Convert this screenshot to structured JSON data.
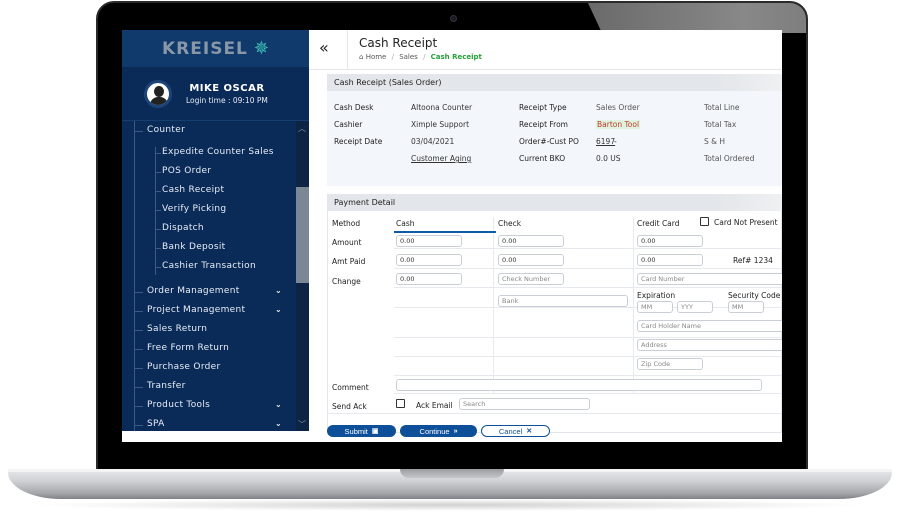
{
  "brand": {
    "name": "KREISEL",
    "logo_icon": "star-burst-icon",
    "logo_color": "#3fc0b6"
  },
  "user": {
    "name": "MIKE OSCAR",
    "login_time": "Login time : 09:10 PM"
  },
  "sidebar": {
    "groups": [
      {
        "label": "Counter",
        "expanded": true,
        "children": [
          {
            "label": "Expedite Counter Sales"
          },
          {
            "label": "POS Order"
          },
          {
            "label": "Cash Receipt"
          },
          {
            "label": "Verify Picking"
          },
          {
            "label": "Dispatch"
          },
          {
            "label": "Bank Deposit"
          },
          {
            "label": "Cashier Transaction"
          }
        ]
      },
      {
        "label": "Order Management",
        "has_children": true
      },
      {
        "label": "Project Management",
        "has_children": true
      },
      {
        "label": "Sales Return"
      },
      {
        "label": "Free Form Return"
      },
      {
        "label": "Purchase Order"
      },
      {
        "label": "Transfer"
      },
      {
        "label": "Product Tools",
        "has_children": true
      },
      {
        "label": "SPA",
        "has_children": true
      }
    ]
  },
  "header": {
    "collapse_icon": "double-chevron-left-icon",
    "title": "Cash Receipt",
    "breadcrumb": [
      {
        "label": "Home",
        "icon": "home-icon"
      },
      {
        "label": "Sales"
      },
      {
        "label": "Cash Receipt",
        "active": true
      }
    ]
  },
  "receipt_section": {
    "title": "Cash Receipt (Sales Order)",
    "fields": {
      "cash_desk_label": "Cash Desk",
      "cash_desk": "Altoona Counter",
      "cashier_label": "Cashier",
      "cashier": "Ximple Support",
      "receipt_date_label": "Receipt Date",
      "receipt_date": "03/04/2021",
      "customer_aging_link": "Customer Aging",
      "receipt_type_label": "Receipt Type",
      "receipt_type": "Sales Order",
      "receipt_from_label": "Receipt From",
      "receipt_from": "Barton Tool",
      "order_cust_po_label": "Order#-Cust PO",
      "order_number": "6197",
      "cust_po": "-",
      "current_bko_label": "Current BKO",
      "current_bko": "0.0 US",
      "total_line_label": "Total Line",
      "total_tax_label": "Total Tax",
      "sh_label": "S & H",
      "total_ordered_label": "Total Ordered"
    }
  },
  "payment_section": {
    "title": "Payment Detail",
    "row_labels": {
      "method": "Method",
      "amount": "Amount",
      "amt_paid": "Amt Paid",
      "change": "Change",
      "comment": "Comment",
      "send_ack": "Send Ack"
    },
    "cash": {
      "header": "Cash",
      "amount": "0.00",
      "amt_paid": "0.00",
      "change": "0.00"
    },
    "check": {
      "header": "Check",
      "amount": "0.00",
      "amt_paid": "0.00",
      "check_number_placeholder": "Check Number",
      "bank_placeholder": "Bank"
    },
    "credit_card": {
      "header": "Credit Card",
      "card_not_present_label": "Card Not Present",
      "card_not_present": false,
      "amount": "0.00",
      "amt_paid": "0.00",
      "ref": "Ref# 1234",
      "card_number_placeholder": "Card Number",
      "expiration_label": "Expiration",
      "exp_month_placeholder": "MM",
      "exp_year_placeholder": "YYY",
      "security_code_label": "Security Code",
      "security_code_placeholder": "MM",
      "card_holder_placeholder": "Card Holder Name",
      "address_placeholder": "Address",
      "zip_placeholder": "Zip Code"
    },
    "comment": "",
    "send_ack": false,
    "ack_email_label": "Ack Email",
    "ack_email_placeholder": "Search"
  },
  "actions": {
    "submit": {
      "label": "Submit",
      "icon": "save-icon"
    },
    "continue": {
      "label": "Continue",
      "icon": "double-chevron-right-icon"
    },
    "cancel": {
      "label": "Cancel",
      "icon": "close-icon"
    }
  }
}
